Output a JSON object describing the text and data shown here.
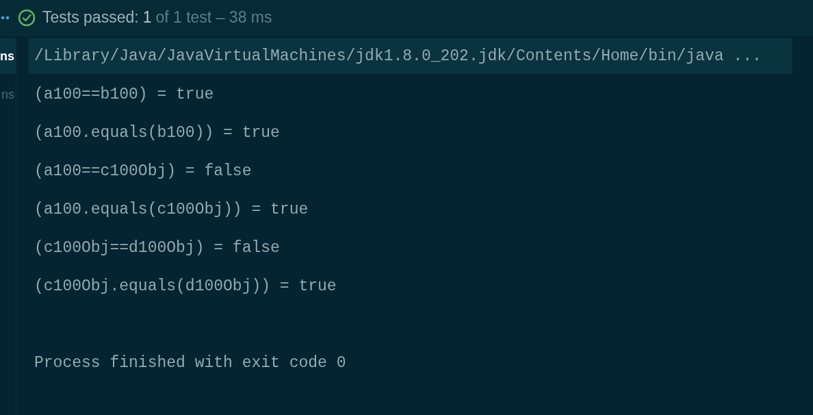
{
  "header": {
    "all_passed": true,
    "status": "Tests passed:",
    "passed": "1",
    "summary": "of 1 test – 38 ms"
  },
  "sidebar": {
    "items": [
      {
        "label": "ns",
        "selected": true
      },
      {
        "label": "ns",
        "selected": false
      }
    ]
  },
  "console": {
    "lines": [
      {
        "kind": "command",
        "text": "/Library/Java/JavaVirtualMachines/jdk1.8.0_202.jdk/Contents/Home/bin/java ..."
      },
      {
        "kind": "output",
        "text": "(a100==b100) = true"
      },
      {
        "kind": "output",
        "text": "(a100.equals(b100)) = true"
      },
      {
        "kind": "output",
        "text": "(a100==c100Obj) = false"
      },
      {
        "kind": "output",
        "text": "(a100.equals(c100Obj)) = true"
      },
      {
        "kind": "output",
        "text": "(c100Obj==d100Obj) = false"
      },
      {
        "kind": "output",
        "text": "(c100Obj.equals(d100Obj)) = true"
      },
      {
        "kind": "exit",
        "text": "Process finished with exit code 0"
      }
    ]
  }
}
